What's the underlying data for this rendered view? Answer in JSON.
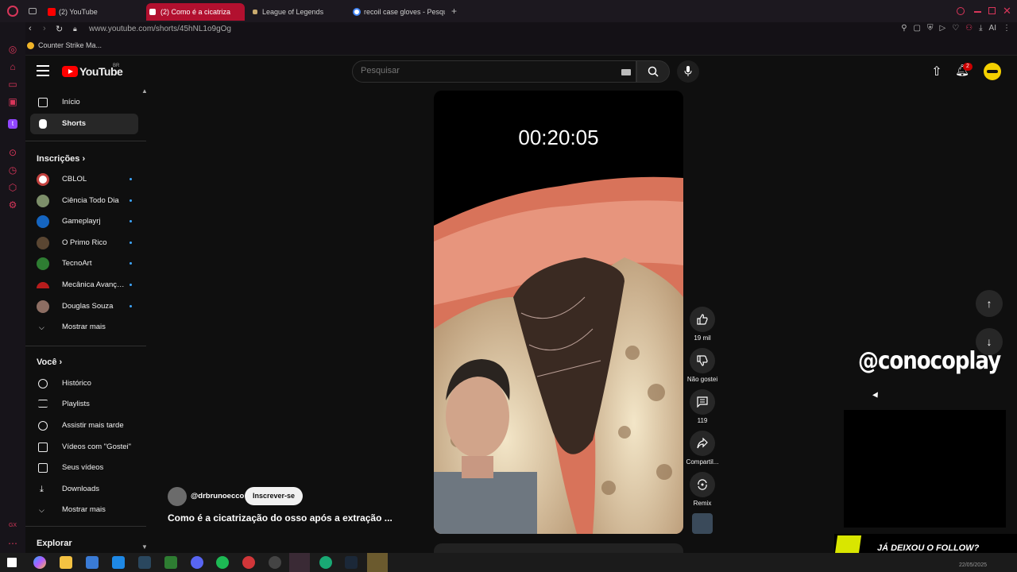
{
  "browser": {
    "tabs": [
      {
        "label": "(2) YouTube",
        "icon": "youtube-icon",
        "color": "#ff0000"
      },
      {
        "label": "(2) Como é a cicatriza",
        "icon": "speaker-icon",
        "color": "#ffffff"
      },
      {
        "label": "League of Legends",
        "icon": "league-icon",
        "color": "#c8aa6e"
      },
      {
        "label": "recoil case gloves - Pesqu",
        "icon": "google-icon",
        "color": "#4285f4"
      }
    ],
    "new_tab": "+",
    "url": "www.youtube.com/shorts/45hNL1o9gOg",
    "ai_label": "AI",
    "bookmark": "Counter Strike Ma..."
  },
  "header": {
    "logo_text": "YouTube",
    "country": "BR",
    "search_placeholder": "Pesquisar",
    "notification_count": "2"
  },
  "sidebar": {
    "main": [
      {
        "label": "Início",
        "icon": "home-icon"
      },
      {
        "label": "Shorts",
        "icon": "shorts-icon",
        "active": true
      }
    ],
    "subscriptions_title": "Inscrições",
    "subscriptions": [
      {
        "label": "CBLOL",
        "color": "#c3423f"
      },
      {
        "label": "Ciência Todo Dia",
        "color": "#7d8f6a"
      },
      {
        "label": "Gameplayrj",
        "color": "#1565c0"
      },
      {
        "label": "O Primo Rico",
        "color": "#5a4632"
      },
      {
        "label": "TecnoArt",
        "color": "#2e7d32"
      },
      {
        "label": "Mecânica Avançada",
        "color": "#b71c1c"
      },
      {
        "label": "Douglas Souza",
        "color": "#8d6e63"
      }
    ],
    "show_more_1": "Mostrar mais",
    "you_title": "Você",
    "you_items": [
      {
        "label": "Histórico",
        "icon": "history-icon"
      },
      {
        "label": "Playlists",
        "icon": "playlist-icon"
      },
      {
        "label": "Assistir mais tarde",
        "icon": "clock-icon"
      },
      {
        "label": "Vídeos com \"Gostei\"",
        "icon": "thumbs-up-icon"
      },
      {
        "label": "Seus vídeos",
        "icon": "video-icon"
      },
      {
        "label": "Downloads",
        "icon": "download-icon"
      }
    ],
    "show_more_2": "Mostrar mais",
    "explore_title": "Explorar"
  },
  "short": {
    "timer": "00:20:05",
    "channel": "@drbrunoecco",
    "subscribe_label": "Inscrever-se",
    "title": "Como é a cicatrização do osso após a extração ...",
    "actions": {
      "likes": "19 mil",
      "dislike": "Não gostei",
      "comments": "119",
      "share": "Compartil...",
      "remix": "Remix"
    }
  },
  "overlay": {
    "handle": "@conocoplay",
    "follow_text": "JÁ DEIXOU O FOLLOW?"
  },
  "taskbar": {
    "date": "22/05/2025"
  }
}
